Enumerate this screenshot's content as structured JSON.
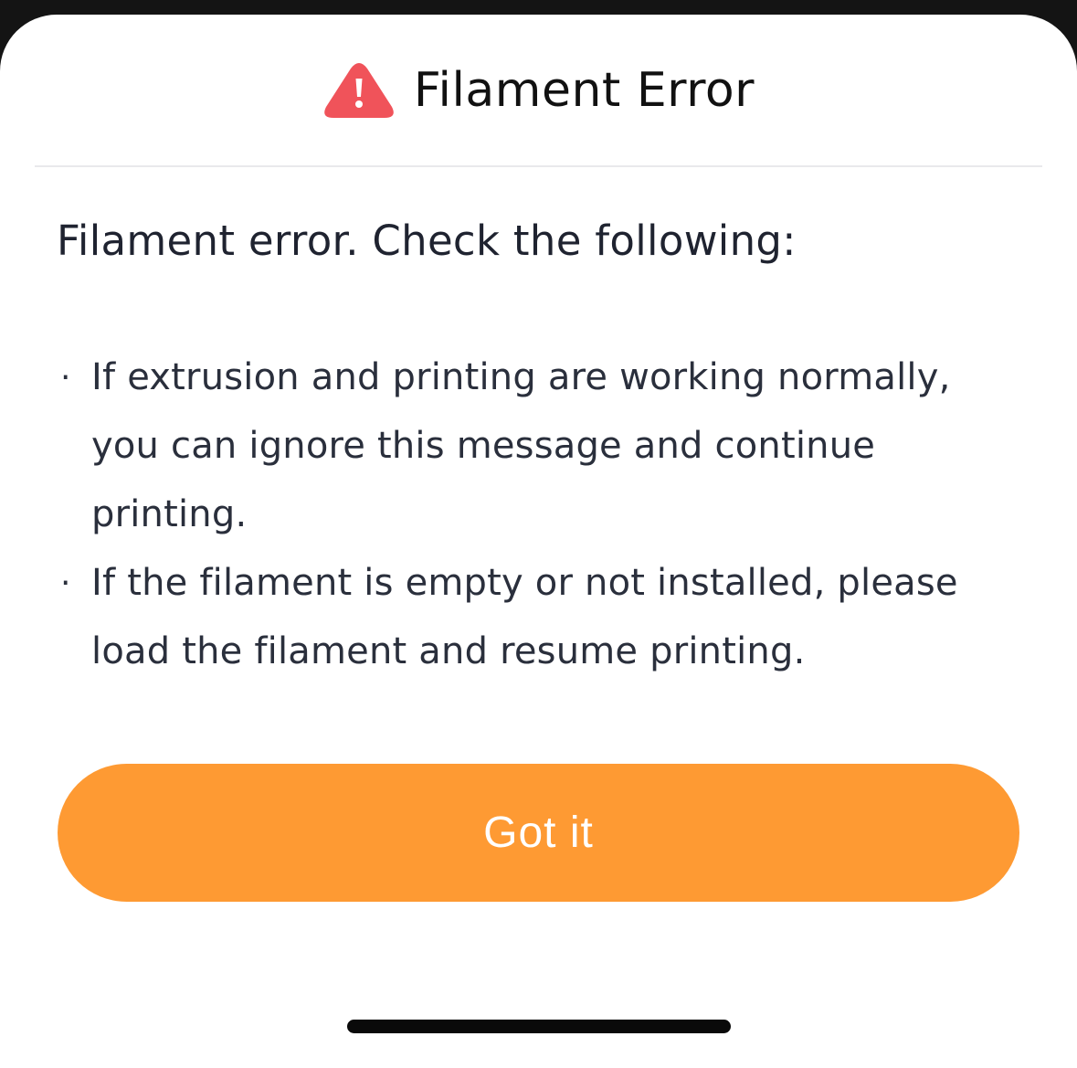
{
  "dialog": {
    "title": "Filament Error",
    "header_icon": "warning-triangle-icon",
    "subtitle": "Filament error. Check the following:",
    "items": [
      {
        "bullet": "·",
        "text": "If extrusion and printing are working normally, you can ignore this message and continue printing."
      },
      {
        "bullet": "·",
        "text": "If the filament is empty or not installed, please load the filament and resume printing."
      }
    ],
    "confirm_label": "Got it"
  },
  "colors": {
    "accent": "#fe9a33",
    "warning": "#f0535a",
    "text": "#2a2f3c"
  }
}
